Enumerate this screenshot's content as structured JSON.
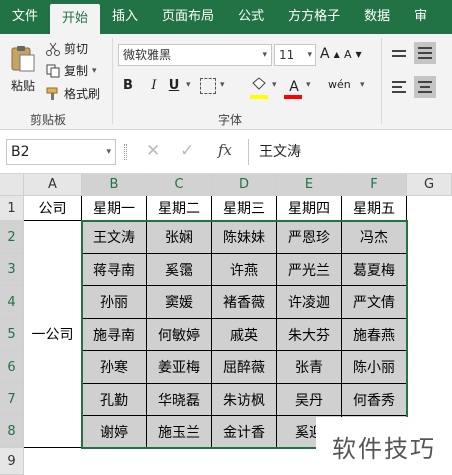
{
  "tabs": [
    "文件",
    "开始",
    "插入",
    "页面布局",
    "公式",
    "方方格子",
    "数据",
    "审"
  ],
  "active_tab": "开始",
  "clipboard": {
    "paste": "粘贴",
    "cut": "剪切",
    "copy": "复制",
    "format_painter": "格式刷",
    "group_label": "剪贴板"
  },
  "font": {
    "name": "微软雅黑",
    "size": "11",
    "bold": "B",
    "italic": "I",
    "underline": "U",
    "group_label": "字体",
    "grow": "A",
    "shrink": "A",
    "phonetic": "wén",
    "fill_color": "#ffff00",
    "font_color": "#ff0000"
  },
  "formula_bar": {
    "name_box": "B2",
    "fx": "fx",
    "content": "王文涛"
  },
  "columns": [
    "A",
    "B",
    "C",
    "D",
    "E",
    "F",
    "G"
  ],
  "rows": [
    "1",
    "2",
    "3",
    "4",
    "5",
    "6",
    "7",
    "8",
    "9"
  ],
  "sheet": {
    "a1": "公司",
    "merged_a": "一公司",
    "headers": [
      "星期一",
      "星期二",
      "星期三",
      "星期四",
      "星期五"
    ],
    "data": [
      [
        "王文涛",
        "张娴",
        "陈妹妹",
        "严恩珍",
        "冯杰"
      ],
      [
        "蒋寻南",
        "奚霭",
        "许燕",
        "严光兰",
        "葛夏梅"
      ],
      [
        "孙丽",
        "窦媛",
        "褚香薇",
        "许凌迦",
        "严文倩"
      ],
      [
        "施寻南",
        "何敏婷",
        "戚英",
        "朱大芬",
        "施春燕"
      ],
      [
        "孙寒",
        "姜亚梅",
        "屈醉薇",
        "张青",
        "陈小丽"
      ],
      [
        "孔勤",
        "华晓磊",
        "朱访枫",
        "吴丹",
        "何香秀"
      ],
      [
        "谢婷",
        "施玉兰",
        "金计香",
        "奚迎",
        ""
      ]
    ]
  },
  "watermark": "软件技巧",
  "accent_color": "#217346"
}
